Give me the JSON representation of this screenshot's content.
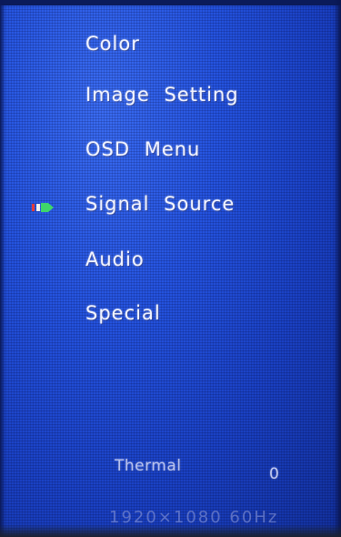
{
  "osd_menu": {
    "items": [
      {
        "label": "Color"
      },
      {
        "label": "Image  Setting"
      },
      {
        "label": "OSD  Menu"
      },
      {
        "label": "Signal  Source"
      },
      {
        "label": "Audio"
      },
      {
        "label": "Special"
      }
    ],
    "selected_index": 3,
    "selector_icon": "selector-arrow-icon",
    "selector_colors": [
      "#e23a3a",
      "#3fd66a"
    ]
  },
  "status": {
    "label": "Thermal",
    "value": "0",
    "resolution": "1920×1080 60Hz"
  },
  "colors": {
    "background": "#2453df",
    "text": "#f2f4ff"
  }
}
